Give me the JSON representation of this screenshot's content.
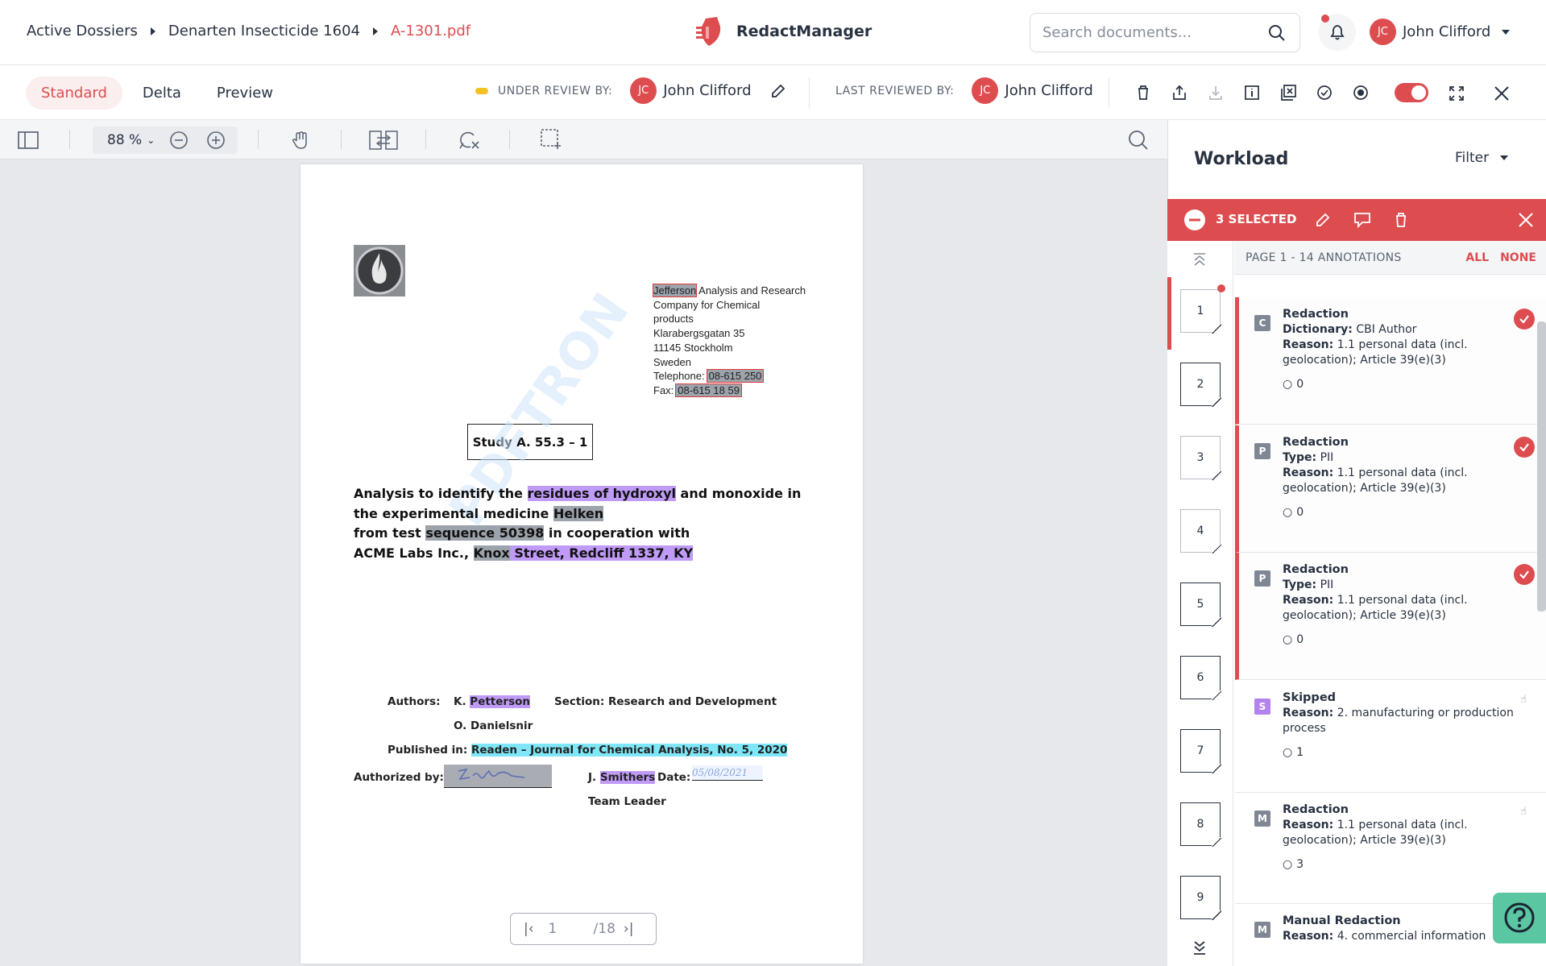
{
  "breadcrumb": {
    "items": [
      "Active Dossiers",
      "Denarten Insecticide 1604",
      "A-1301.pdf"
    ]
  },
  "app": {
    "name": "RedactManager"
  },
  "search": {
    "placeholder": "Search documents..."
  },
  "user": {
    "initials": "JC",
    "name": "John Clifford"
  },
  "view_tabs": [
    "Standard",
    "Delta",
    "Preview"
  ],
  "review": {
    "under_review_label": "UNDER REVIEW BY:",
    "under_review_user": "John Clifford",
    "last_reviewed_label": "LAST REVIEWED BY:",
    "last_reviewed_user": "John Clifford"
  },
  "viewer": {
    "zoom": "88 %",
    "current_page": "1",
    "total_pages": "/18"
  },
  "document": {
    "address": [
      "Jefferson",
      "Analysis and Research",
      "Company for Chemical",
      "products",
      "Klarabergsgatan 35",
      "11145 Stockholm",
      "Sweden"
    ],
    "telephone_label": "Telephone:",
    "telephone": "08-615 250",
    "fax_label": "Fax:",
    "fax": "08-615 18 59",
    "study": "Study A. 55.3 – 1",
    "title": {
      "l1a": "Analysis to identify the ",
      "l1b": "residues of hydroxyl",
      "l1c": " and monoxide in",
      "l2a": "the experimental medicine ",
      "l2b": "Helken",
      "l3a": "from test ",
      "l3b": "sequence 50398",
      "l3c": " in cooperation with",
      "l4a": "ACME Labs Inc., ",
      "l4b": "Knox",
      "l4c": " Street, Redcliff 1337, KY"
    },
    "authors_label": "Authors:",
    "author1_initial": "K. ",
    "author1": "Petterson",
    "author2": "O. Danielsnir",
    "section": "Section: Research and Development",
    "published_label": "Published in: ",
    "published": "Readen – Journal for Chemical Analysis, No. 5, 2020",
    "authorized_label": "Authorized by:",
    "signer_initial": "J. ",
    "signer": "Smithers",
    "date_label": "Date:",
    "date_value": "05/08/2021",
    "role": "Team Leader",
    "watermark": "PDFTRON"
  },
  "workload": {
    "title": "Workload",
    "filter": "Filter",
    "selected": "3 SELECTED",
    "page_header": "PAGE 1 - 14 ANNOTATIONS",
    "all": "ALL",
    "none": "NONE",
    "thumbs": [
      "1",
      "2",
      "3",
      "4",
      "5",
      "6",
      "7",
      "8",
      "9"
    ],
    "annotations": [
      {
        "badge": "C",
        "title": "Redaction",
        "k1": "Dictionary:",
        "v1": " CBI Author",
        "k2": "Reason:",
        "v2": " 1.1 personal data (incl. geolocation); Article 39(e)(3)",
        "comments": "0"
      },
      {
        "badge": "P",
        "title": "Redaction",
        "k1": "Type:",
        "v1": " PII",
        "k2": "Reason:",
        "v2": " 1.1 personal data (incl. geolocation); Article 39(e)(3)",
        "comments": "0"
      },
      {
        "badge": "P",
        "title": "Redaction",
        "k1": "Type:",
        "v1": " PII",
        "k2": "Reason:",
        "v2": " 1.1 personal data (incl. geolocation); Article 39(e)(3)",
        "comments": "0"
      },
      {
        "badge": "S",
        "title": "Skipped",
        "k2": "Reason:",
        "v2": " 2. manufacturing or production process",
        "comments": "1"
      },
      {
        "badge": "M",
        "title": "Redaction",
        "k2": "Reason:",
        "v2": " 1.1 personal data (incl. geolocation); Article 39(e)(3)",
        "comments": "3"
      },
      {
        "badge": "M",
        "title": "Manual Redaction",
        "k2": "Reason:",
        "v2": " 4. commercial information"
      }
    ]
  },
  "colors": {
    "accent": "#dd4d50",
    "purple_badge": "#b382ec",
    "help": "#5ac6a2"
  }
}
